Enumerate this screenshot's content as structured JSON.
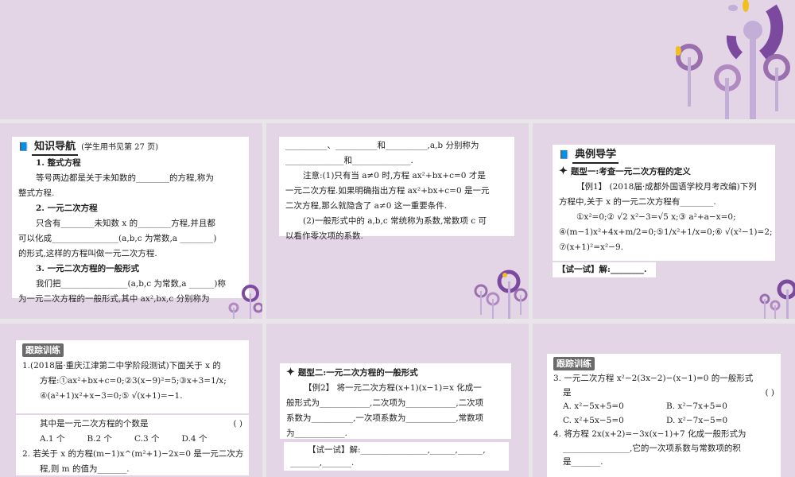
{
  "slide1": {
    "title": "知识导航",
    "note": "(学生用书见第 27 页)",
    "lines": [
      "1. 整式方程",
      "等号两边都是关于未知数的________的方程,称为",
      "整式方程.",
      "2. 一元二次方程",
      "只含有________未知数 x 的________方程,并且都",
      "可以化成________________(a,b,c 为常数,a ________)",
      "的形式,这样的方程叫做一元二次方程.",
      "3. 一元二次方程的一般形式",
      "我们把________________(a,b,c 为常数,a ______)称",
      "为一元二次方程的一般形式,其中 ax²,bx,c 分别称为"
    ]
  },
  "slide2": {
    "lines": [
      "__________、__________和__________,a,b 分别称为",
      "______________和______________.",
      "注意:(1)只有当 a≠0 时,方程 ax²+bx+c=0 才是",
      "一元二次方程.如果明确指出方程 ax²+bx+c=0 是一元",
      "二次方程,那么就隐含了 a≠0 这一重要条件.",
      "(2)一般形式中的 a,b,c 常统称为系数,常数项 c 可",
      "以看作零次项的系数."
    ]
  },
  "slide3": {
    "title": "典例导学",
    "type": "题型一:考查一元二次方程的定义",
    "lines": [
      "【例1】 (2018届·成都外国语学校月考改编)下列",
      "方程中,关于 x 的一元二次方程有________.",
      "①x²=0;② √2 x²−3=√5 x;③ a²+a−x=0;",
      "④(m−1)x²+4x+m/2=0;⑤1/x²+1/x=0;⑥ √(x²−1)=2;",
      "⑦(x+1)²=x²−9."
    ],
    "try": "【试一试】解:________."
  },
  "slide4": {
    "tag": "跟踪训练",
    "lines": [
      "1.(2018届·重庆江津第二中学阶段测试)下面关于 x 的",
      "方程:①ax²+bx+c=0;②3(x−9)²=5;③x+3=1/x;",
      "④(a²+1)x²+x−3=0;⑤ √(x+1)=−1."
    ],
    "q": "其中是一元二次方程的个数是",
    "paren": "(      )",
    "options": [
      "A.1 个",
      "B.2 个",
      "C.3 个",
      "D.4 个"
    ],
    "q2": [
      "2. 若关于 x 的方程(m−1)x^(m²+1)−2x=0 是一元二次方",
      "程,则 m 的值为_______."
    ]
  },
  "slide5": {
    "type": "题型二:一元二次方程的一般形式",
    "lines": [
      "【例2】 将一元二次方程(x+1)(x−1)=x 化成一",
      "般形式为____________,二次项为____________,二次项",
      "系数为__________,一次项系数为____________,常数项",
      "为____________."
    ],
    "try": [
      "【试一试】解:________________,______,______,",
      "_______,_______."
    ]
  },
  "slide6": {
    "tag": "跟踪训练",
    "q3": "3. 一元二次方程 x²−2(3x−2)−(x−1)=0 的一般形式",
    "q3b": "是",
    "paren": "(      )",
    "options": [
      "A. x²−5x+5=0",
      "B. x²−7x+5=0",
      "C. x²+5x−5=0",
      "D. x²−7x−5=0"
    ],
    "q4": [
      "4. 将方程 2x(x+2)=−3x(x−1)+7 化成一般形式为",
      "________________,它的一次项系数与常数项的积",
      "是_______."
    ]
  }
}
